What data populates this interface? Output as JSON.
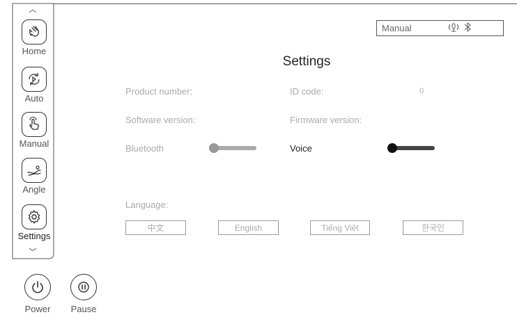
{
  "sidebar": {
    "items": [
      {
        "label": "Home",
        "icon": "hand-wave-icon"
      },
      {
        "label": "Auto",
        "icon": "auto-cycle-icon"
      },
      {
        "label": "Manual",
        "icon": "hand-touch-icon"
      },
      {
        "label": "Angle",
        "icon": "angle-icon"
      },
      {
        "label": "Settings",
        "icon": "gear-icon"
      }
    ]
  },
  "controls": {
    "power_label": "Power",
    "pause_label": "Pause"
  },
  "status": {
    "mode": "Manual",
    "icons": [
      "voice-icon",
      "bluetooth-icon"
    ]
  },
  "page": {
    "title": "Settings"
  },
  "settings": {
    "product_number_label": "Product number:",
    "id_code_label": "ID code:",
    "id_code_value": "0",
    "software_version_label": "Software version:",
    "firmware_version_label": "Firmware version:",
    "bluetooth_label": "Bluetooth",
    "bluetooth_on": false,
    "voice_label": "Voice",
    "voice_on": true,
    "language_label": "Language:",
    "languages": [
      "中文",
      "English",
      "Tiếng Việt",
      "한국인"
    ]
  }
}
